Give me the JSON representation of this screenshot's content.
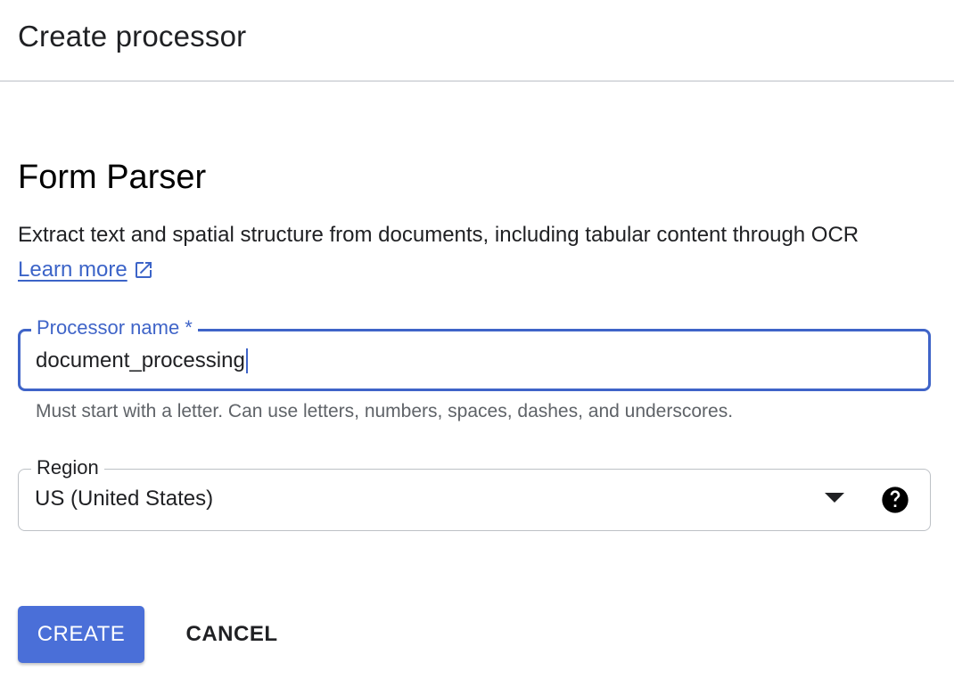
{
  "header": {
    "title": "Create processor"
  },
  "processor": {
    "title": "Form Parser",
    "description": "Extract text and spatial structure from documents, including tabular content through OCR",
    "learn_more": "Learn more",
    "link_icon": "open-in-new-icon"
  },
  "form": {
    "name_field": {
      "label": "Processor name *",
      "value": "document_processing",
      "helper": "Must start with a letter. Can use letters, numbers, spaces, dashes, and underscores."
    },
    "region_field": {
      "label": "Region",
      "value": "US (United States)",
      "dropdown_icon": "arrow-drop-down-icon",
      "help_icon": "help-icon"
    }
  },
  "actions": {
    "create": "CREATE",
    "cancel": "CANCEL"
  },
  "colors": {
    "accent": "#3f64c8",
    "primary_button": "#4a6fd8",
    "text": "#202124",
    "helper_text": "#5f6368",
    "divider": "#dadce0"
  }
}
